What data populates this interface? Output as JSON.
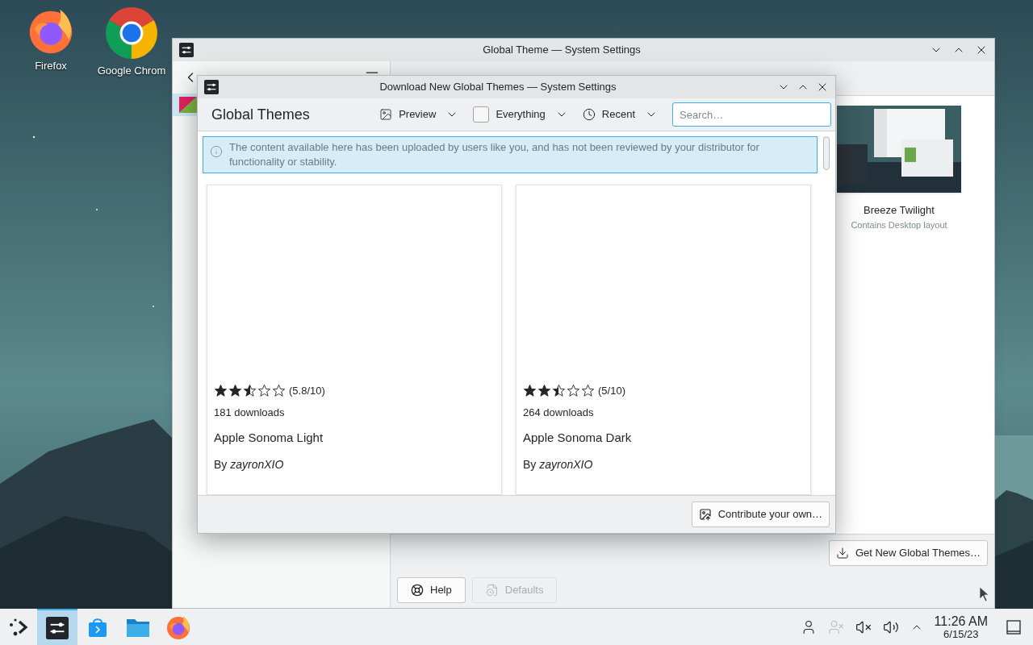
{
  "desktop_icons": [
    {
      "kind": "firefox",
      "label": "Firefox"
    },
    {
      "kind": "chrome",
      "label": "Google Chrom"
    }
  ],
  "settings_window": {
    "title": "Global Theme — System Settings",
    "sidebar": {
      "items": [
        {
          "selected": true
        }
      ]
    },
    "theme": {
      "name": "Breeze Twilight",
      "subtitle": "Contains Desktop layout"
    },
    "get_new_button": "Get New Global Themes…",
    "buttons": [
      {
        "kind": "help",
        "label": "Help",
        "disabled": false
      },
      {
        "kind": "defaults",
        "label": "Defaults",
        "disabled": true
      }
    ]
  },
  "dialog": {
    "title": "Download New Global Themes — System Settings",
    "heading": "Global Themes",
    "filters": [
      {
        "kind": "view",
        "label": "Preview"
      },
      {
        "kind": "checkbox",
        "label": "Everything",
        "checked": false
      },
      {
        "kind": "sort",
        "label": "Recent"
      }
    ],
    "search": {
      "placeholder": "Search…"
    },
    "notice": "The content available here has been uploaded by users like you, and has not been reviewed by your distributor for functionality or stability.",
    "items": [
      {
        "stars": 2.5,
        "rating": "(5.8/10)",
        "downloads": "181 downloads",
        "name": "Apple Sonoma Light",
        "author": "By *zayronXIO*"
      },
      {
        "stars": 2.5,
        "rating": "(5/10)",
        "downloads": "264 downloads",
        "name": "Apple Sonoma Dark",
        "author": "By *zayronXIO*"
      }
    ],
    "contribute_button": "Contribute your own…"
  },
  "taskbar": {
    "apps": [
      {
        "kind": "settings",
        "selected": true
      },
      {
        "kind": "store",
        "selected": false
      },
      {
        "kind": "files",
        "selected": false
      },
      {
        "kind": "firefox",
        "selected": false
      }
    ],
    "time": "11:26 AM",
    "date": "6/15/23"
  }
}
